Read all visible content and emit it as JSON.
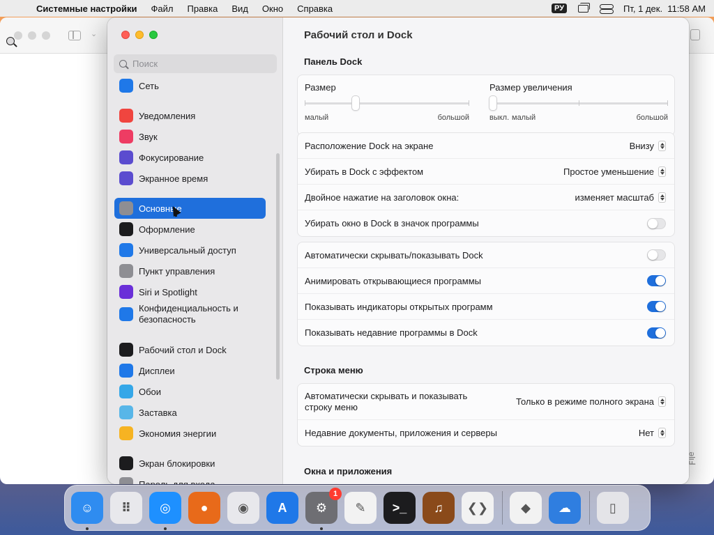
{
  "menubar": {
    "apple": "",
    "app_name": "Системные настройки",
    "items": [
      "Файл",
      "Правка",
      "Вид",
      "Окно",
      "Справка"
    ],
    "keyboard_layout": "РУ",
    "datetime": "Пт, 1 дек.  11:58 AM"
  },
  "background_window": {
    "edge_text": "ǝlᴉℲ"
  },
  "sidebar": {
    "search_placeholder": "Поиск",
    "items": [
      {
        "label": "Сеть",
        "icon": "network-icon",
        "color": "#1f78e8"
      },
      {
        "label": "Уведомления",
        "icon": "bell-icon",
        "color": "#f0453f"
      },
      {
        "label": "Звук",
        "icon": "speaker-icon",
        "color": "#ee3c63"
      },
      {
        "label": "Фокусирование",
        "icon": "moon-icon",
        "color": "#5b4ccf"
      },
      {
        "label": "Экранное время",
        "icon": "hourglass-icon",
        "color": "#5b4ccf"
      },
      {
        "label": "Основные",
        "icon": "gear-icon",
        "color": "#8e8e93"
      },
      {
        "label": "Оформление",
        "icon": "appearance-icon",
        "color": "#1c1c1e"
      },
      {
        "label": "Универсальный доступ",
        "icon": "accessibility-icon",
        "color": "#1f78e8"
      },
      {
        "label": "Пункт управления",
        "icon": "control-center-icon",
        "color": "#8e8e93"
      },
      {
        "label": "Siri и Spotlight",
        "icon": "siri-icon",
        "color": "#6a2fd8"
      },
      {
        "label": "Конфиденциальность и\nбезопасность",
        "icon": "hand-icon",
        "color": "#1f78e8"
      },
      {
        "label": "Рабочий стол и Dock",
        "icon": "dock-icon",
        "color": "#1c1c1e"
      },
      {
        "label": "Дисплеи",
        "icon": "display-icon",
        "color": "#1f78e8"
      },
      {
        "label": "Обои",
        "icon": "wallpaper-icon",
        "color": "#35a7e8"
      },
      {
        "label": "Заставка",
        "icon": "screensaver-icon",
        "color": "#58b6e8"
      },
      {
        "label": "Экономия энергии",
        "icon": "bulb-icon",
        "color": "#f6b322"
      },
      {
        "label": "Экран блокировки",
        "icon": "lock-icon",
        "color": "#1c1c1e"
      },
      {
        "label": "Пароль для входа",
        "icon": "key-icon",
        "color": "#8e8e93"
      }
    ],
    "selected": "Основные"
  },
  "content": {
    "title": "Рабочий стол и Dock",
    "dock_section": {
      "header": "Панель Dock",
      "size_label": "Размер",
      "size_min": "малый",
      "size_max": "большой",
      "size_value": 0.3,
      "mag_label": "Размер увеличения",
      "mag_off": "выкл.",
      "mag_min": "малый",
      "mag_max": "большой",
      "mag_value": 0.0
    },
    "dock_rows": [
      {
        "label": "Расположение Dock на экране",
        "value": "Внизу",
        "type": "popup"
      },
      {
        "label": "Убирать в Dock с эффектом",
        "value": "Простое уменьшение",
        "type": "popup"
      },
      {
        "label": "Двойное нажатие на заголовок окна:",
        "value": "изменяет масштаб",
        "type": "popup"
      },
      {
        "label": "Убирать окно в Dock в значок программы",
        "value": "off",
        "type": "toggle"
      }
    ],
    "dock_rows2": [
      {
        "label": "Автоматически скрывать/показывать Dock",
        "value": "off"
      },
      {
        "label": "Анимировать открывающиеся программы",
        "value": "on"
      },
      {
        "label": "Показывать индикаторы открытых программ",
        "value": "on"
      },
      {
        "label": "Показывать недавние программы в Dock",
        "value": "on"
      }
    ],
    "menubar_section": {
      "header": "Строка меню",
      "rows": [
        {
          "label": "Автоматически скрывать и показывать\nстроку меню",
          "value": "Только в режиме полного экрана"
        },
        {
          "label": "Недавние документы, приложения и серверы",
          "value": "Нет"
        }
      ]
    },
    "windows_section": {
      "header": "Окна и приложения"
    }
  },
  "dock": {
    "apps": [
      {
        "name": "finder-app",
        "glyph": "☺",
        "color": "#2f8cf0",
        "running": true
      },
      {
        "name": "launchpad-app",
        "glyph": "⠿",
        "color": "#e8e8ec",
        "running": false
      },
      {
        "name": "safari-app",
        "glyph": "◎",
        "color": "#1e90ff",
        "running": true
      },
      {
        "name": "firefox-app",
        "glyph": "●",
        "color": "#e86a1a",
        "running": false
      },
      {
        "name": "chrome-app",
        "glyph": "◉",
        "color": "#e8e8ec",
        "running": false
      },
      {
        "name": "app-store-app",
        "glyph": "A",
        "color": "#1f78e8",
        "running": false
      },
      {
        "name": "system-settings-app",
        "glyph": "⚙",
        "color": "#6e6e73",
        "running": true,
        "badge": "1"
      },
      {
        "name": "textedit-app",
        "glyph": "✎",
        "color": "#f2f2f2",
        "running": false
      },
      {
        "name": "terminal-app",
        "glyph": ">_",
        "color": "#1c1c1e",
        "running": false
      },
      {
        "name": "garageband-app",
        "glyph": "♫",
        "color": "#8a4a1a",
        "running": false
      },
      {
        "name": "vscode-app",
        "glyph": "❮❯",
        "color": "#f2f2f2",
        "running": false
      },
      {
        "name": "visual-studio-app",
        "glyph": "◆",
        "color": "#f2f2f2",
        "running": false
      },
      {
        "name": "weather-app",
        "glyph": "☁",
        "color": "#2f7ee0",
        "running": false
      },
      {
        "name": "trash-app",
        "glyph": "▯",
        "color": "#e4e4e8",
        "running": false
      }
    ]
  }
}
